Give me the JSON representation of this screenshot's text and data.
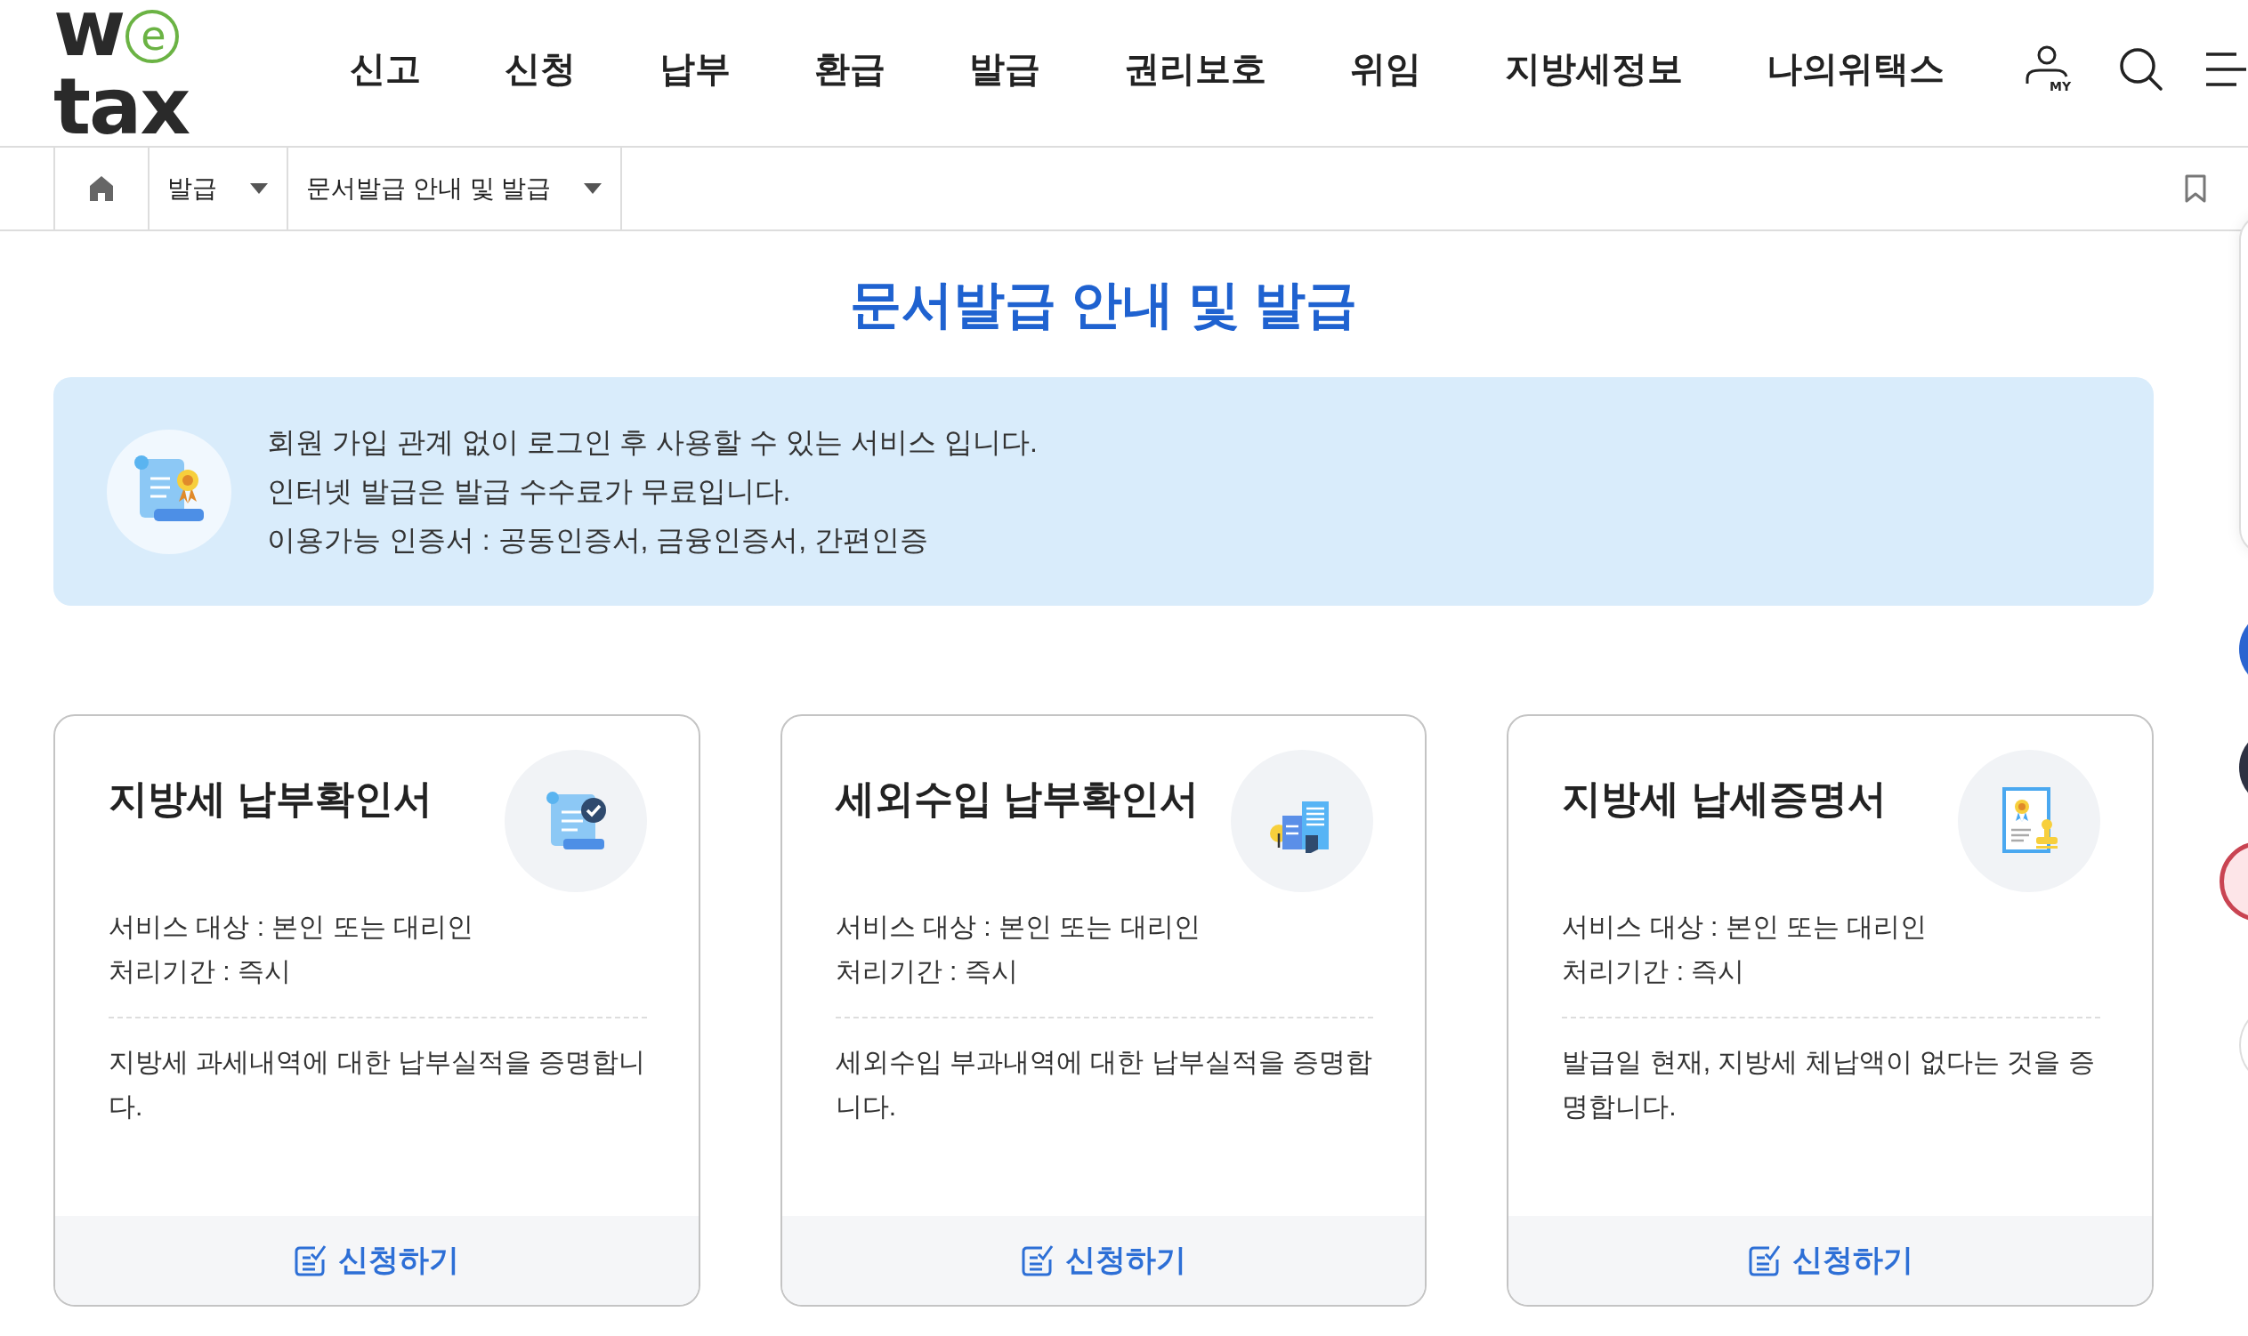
{
  "logo": {
    "text_before": "w",
    "circle_letter": "e",
    "text_after": "tax"
  },
  "nav": [
    "신고",
    "신청",
    "납부",
    "환급",
    "발급",
    "권리보호",
    "위임",
    "지방세정보",
    "나의위택스"
  ],
  "header_icons": {
    "my_label": "MY"
  },
  "breadcrumb": [
    "발급",
    "문서발급 안내 및 발급"
  ],
  "page_title": "문서발급 안내 및 발급",
  "notice": [
    "회원 가입 관계 없이 로그인 후 사용할 수 있는 서비스 입니다.",
    "인터넷 발급은 발급 수수료가 무료입니다.",
    "이용가능 인증서 : 공동인증서, 금융인증서, 간편인증"
  ],
  "cards": [
    {
      "kind": "receipt",
      "title": "지방세 납부확인서",
      "target": "서비스 대상 : 본인 또는 대리인",
      "period": "처리기간 : 즉시",
      "description": "지방세 과세내역에 대한 납부실적을 증명합니다.",
      "button": "신청하기"
    },
    {
      "kind": "building",
      "title": "세외수입 납부확인서",
      "target": "서비스 대상 : 본인 또는 대리인",
      "period": "처리기간 : 즉시",
      "description": "세외수입 부과내역에 대한 납부실적을 증명합니다.",
      "button": "신청하기"
    },
    {
      "kind": "certificate",
      "title": "지방세 납세증명서",
      "target": "서비스 대상 : 본인 또는 대리인",
      "period": "처리기간 : 즉시",
      "description": "발급일 현재, 지방세 체납액이 없다는 것을 증명합니다.",
      "button": "신청하기"
    }
  ]
}
